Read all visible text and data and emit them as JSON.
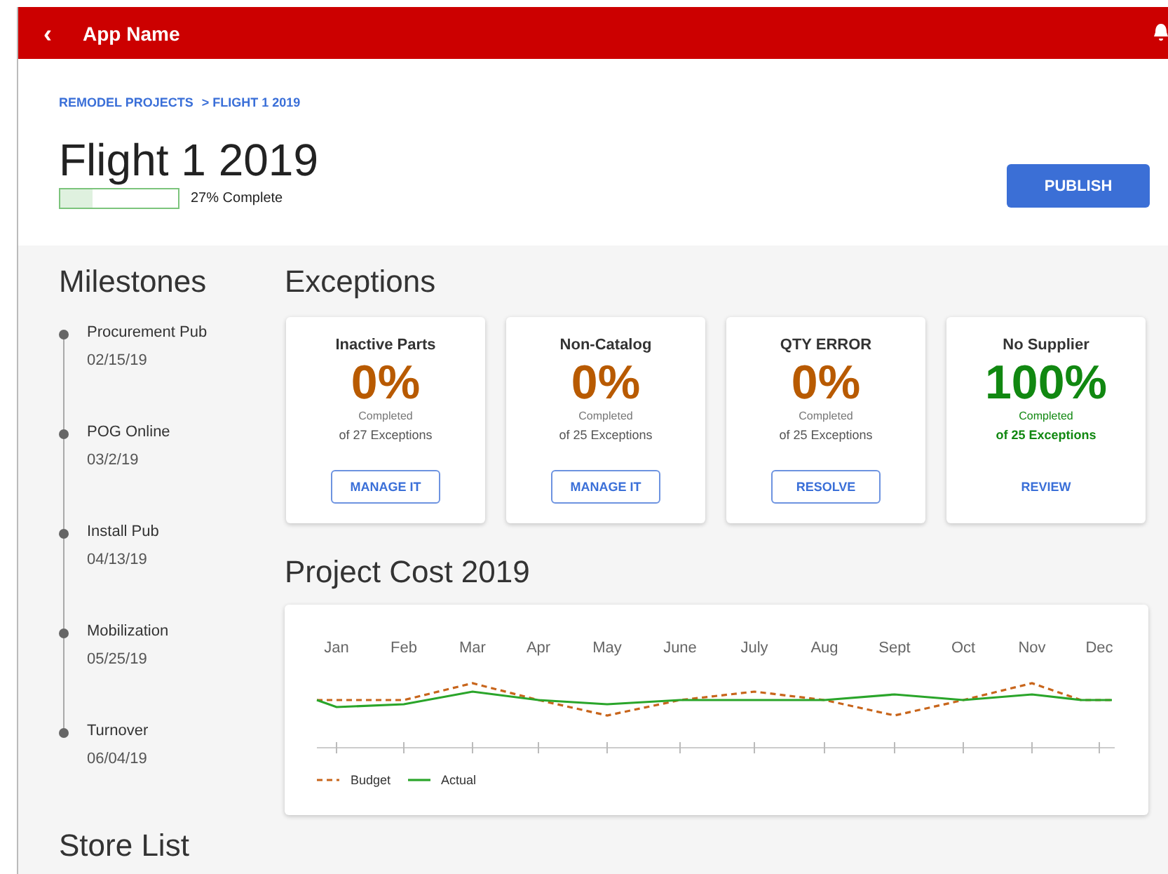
{
  "app_bar": {
    "back_icon": "‹",
    "title": "App Name"
  },
  "breadcrumb": [
    {
      "label": "REMODEL PROJECTS"
    },
    {
      "label": "> FLIGHT 1 2019"
    }
  ],
  "page": {
    "title": "Flight 1 2019",
    "progress": {
      "level": 0.27,
      "label": "27% Complete"
    },
    "publish_button": "PUBLISH"
  },
  "milestones": {
    "heading": "Milestones",
    "items": [
      {
        "name": "Procurement Pub",
        "date": "02/15/19"
      },
      {
        "name": "POG Online",
        "date": "03/2/19"
      },
      {
        "name": "Install Pub",
        "date": "04/13/19"
      },
      {
        "name": "Mobilization",
        "date": "05/25/19"
      },
      {
        "name": "Turnover",
        "date": "06/04/19"
      }
    ]
  },
  "store_list": {
    "heading": "Store List"
  },
  "exceptions": {
    "heading": "Exceptions",
    "cards": [
      {
        "title": "Inactive Parts",
        "percent": "0%",
        "caption": "Completed",
        "count": "of 27 Exceptions",
        "complete": false,
        "action": {
          "label": "MANAGE IT",
          "kind": "outlined"
        }
      },
      {
        "title": "Non-Catalog",
        "percent": "0%",
        "caption": "Completed",
        "count": "of 25 Exceptions",
        "complete": false,
        "action": {
          "label": "MANAGE IT",
          "kind": "outlined"
        }
      },
      {
        "title": "QTY ERROR",
        "percent": "0%",
        "caption": "Completed",
        "count": "of 25 Exceptions",
        "complete": false,
        "action": {
          "label": "RESOLVE",
          "kind": "outlined"
        }
      },
      {
        "title": "No Supplier",
        "percent": "100%",
        "caption": "Completed",
        "count": "of 25 Exceptions",
        "complete": true,
        "action": {
          "label": "REVIEW",
          "kind": "text"
        }
      }
    ]
  },
  "project_cost": {
    "heading": "Project Cost 2019",
    "months": [
      "Jan",
      "Feb",
      "Mar",
      "Apr",
      "May",
      "June",
      "July",
      "Aug",
      "Sept",
      "Oct",
      "Nov",
      "Dec"
    ],
    "legend": [
      {
        "label": "Budget",
        "color": "#c8651b",
        "kind": "dashed"
      },
      {
        "label": "Actual",
        "color": "#2aa52a",
        "kind": "solid"
      }
    ]
  }
}
